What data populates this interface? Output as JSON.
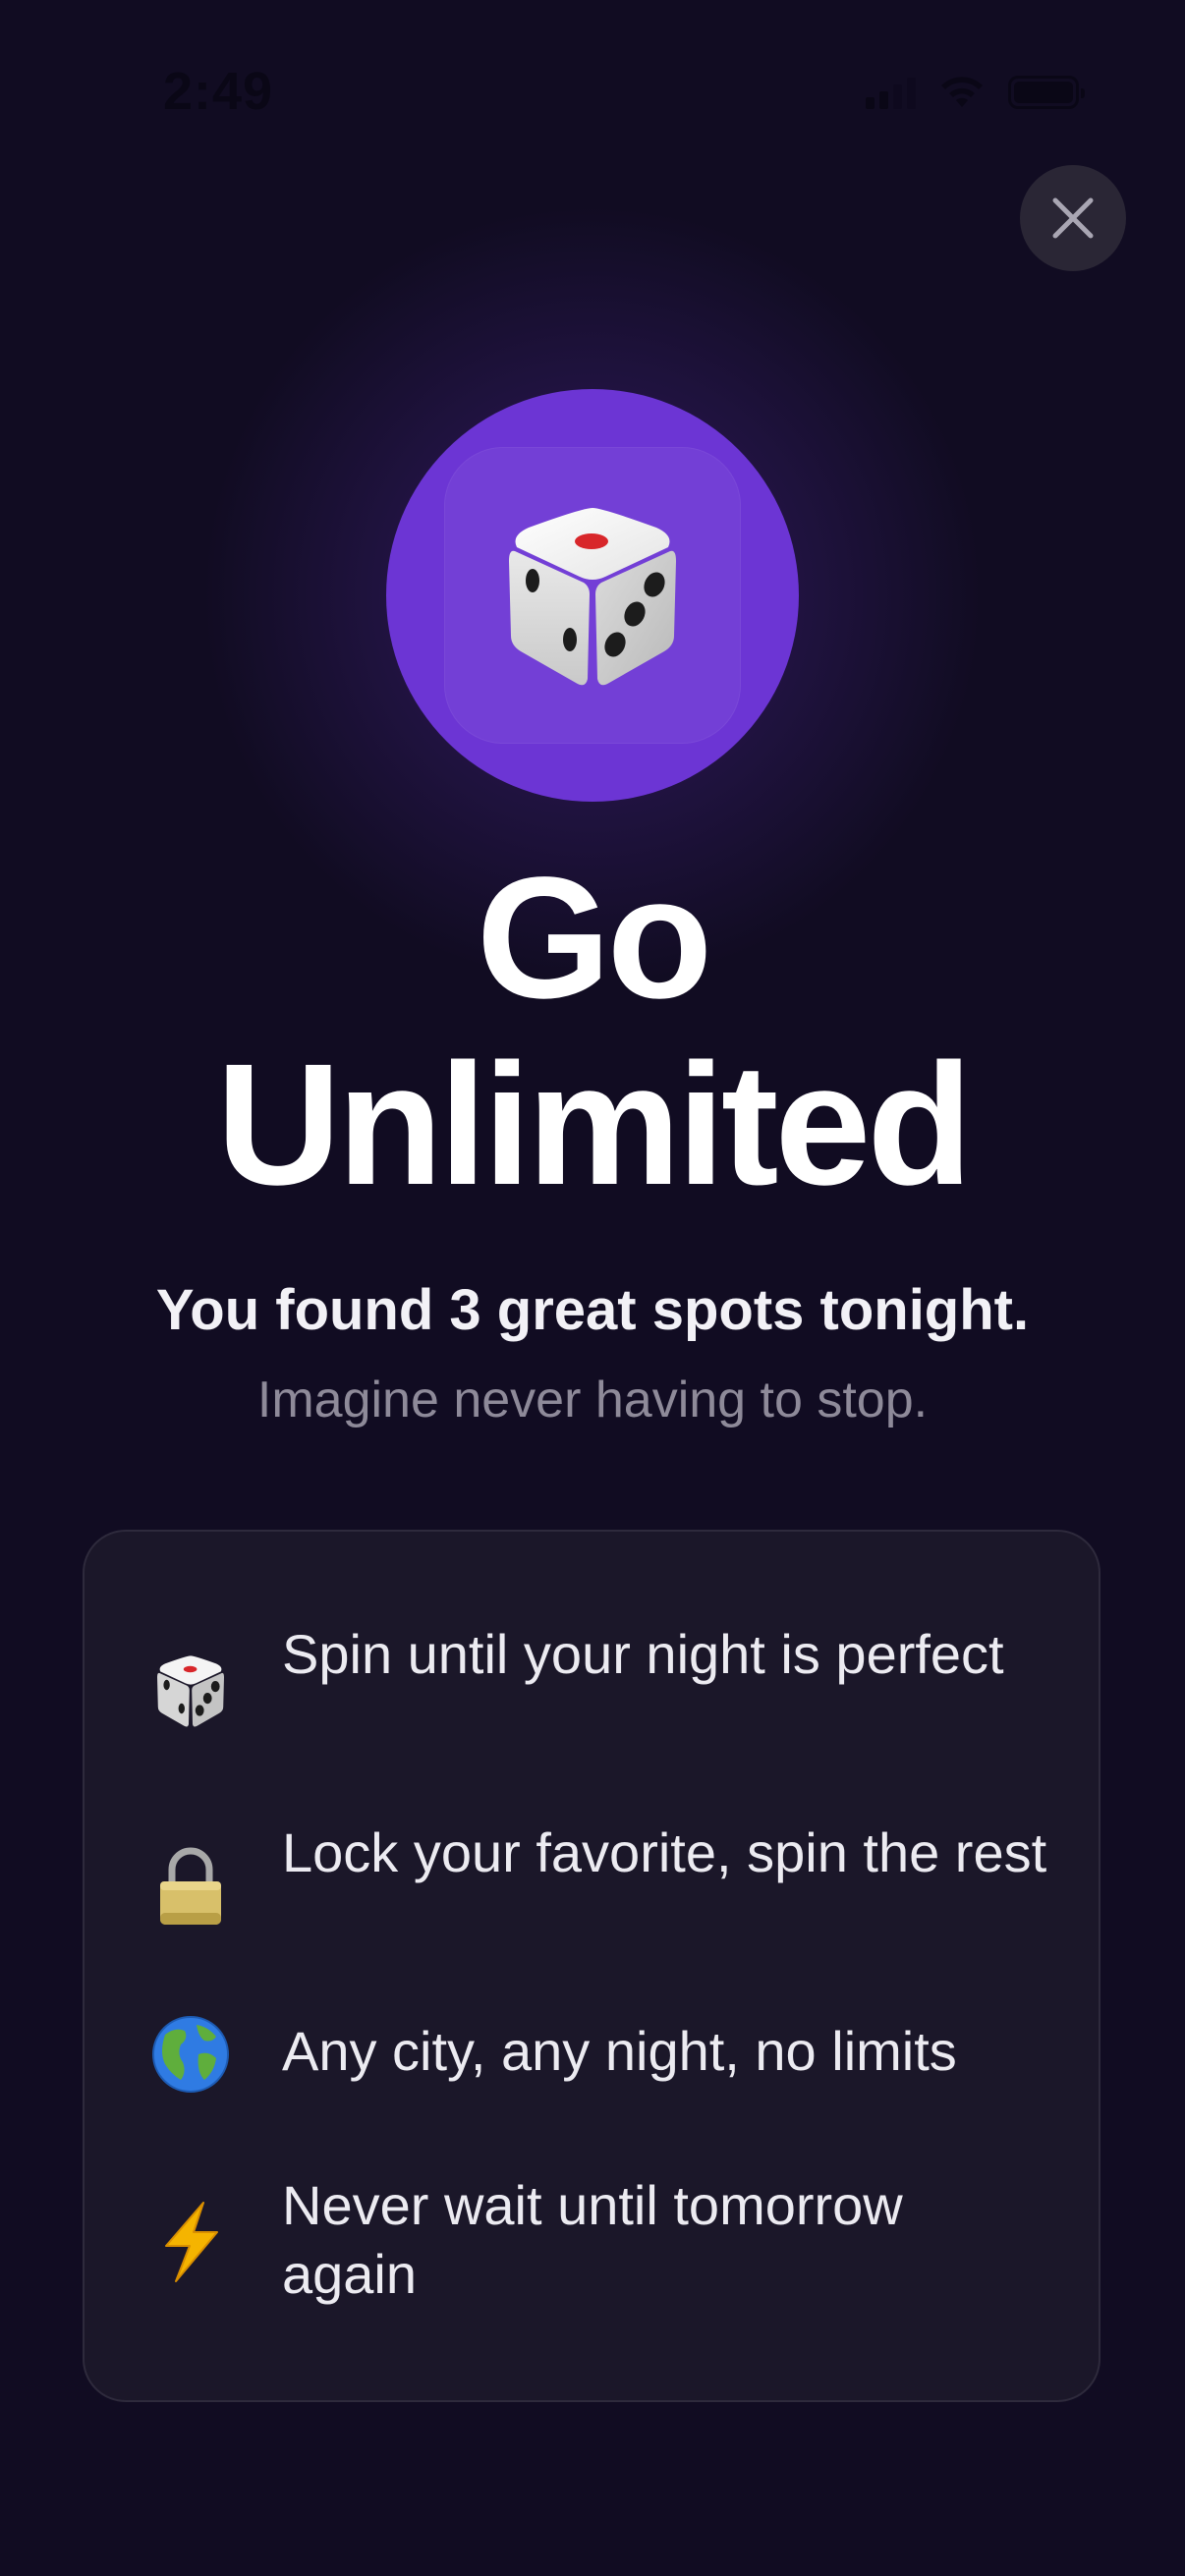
{
  "status_bar": {
    "time": "2:49"
  },
  "close_button": {
    "icon": "close-icon"
  },
  "hero": {
    "icon": "dice-icon",
    "accent_color": "#6c35d4"
  },
  "title": {
    "line1": "Go",
    "line2": "Unlimited"
  },
  "subtitle": "You found 3 great spots tonight.",
  "tagline": "Imagine never having to stop.",
  "features": [
    {
      "icon": "dice-icon",
      "text": "Spin until your night is perfect"
    },
    {
      "icon": "lock-icon",
      "text": "Lock your favorite, spin the rest"
    },
    {
      "icon": "globe-icon",
      "text": "Any city, any night, no limits"
    },
    {
      "icon": "lightning-icon",
      "text": "Never wait until tomorrow again"
    }
  ],
  "colors": {
    "background": "#110c22",
    "card": "#1b1729",
    "accent": "#6c35d4"
  }
}
